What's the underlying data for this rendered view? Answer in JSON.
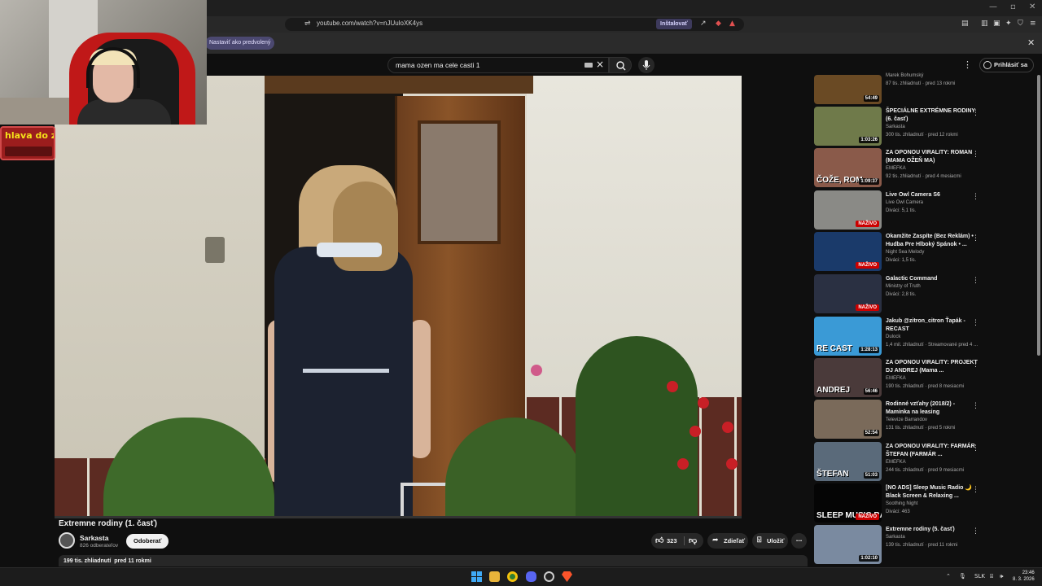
{
  "browser": {
    "url": "youtube.com/watch?v=nJUuloXK4ys",
    "install_label": "Inštalovať",
    "set_default_label": "Nastaviť ako predvolený",
    "infobar_close": "✕"
  },
  "masthead": {
    "search_query": "mama ozen ma cele casti 1",
    "signin_label": "Prihlásiť sa"
  },
  "video": {
    "title": "Extremne rodiny (1. časť)",
    "channel": "Sarkasta",
    "subscribers": "826 odberateľov",
    "subscribe_label": "Odoberať",
    "likes": "323",
    "share_label": "Zdieľať",
    "save_label": "Uložiť",
    "views": "199 tis. zhliadnutí",
    "age": "pred 11 rokmi"
  },
  "webcam": {
    "label": "hlava do ze"
  },
  "recommendations": [
    {
      "title": "",
      "channel": "Marek Bohumský",
      "meta": "87 tis. zhliadnutí · pred 13 rokmi",
      "duration": "54:49",
      "thumb": "#6a4a24",
      "overlay": ""
    },
    {
      "title": "ŠPECIÁLNE EXTRÉMNE RODINY (6. časť)",
      "channel": "Sarkasta",
      "meta": "300 tis. zhliadnutí · pred 12 rokmi",
      "duration": "1:03:26",
      "thumb": "#6f7a4a",
      "overlay": ""
    },
    {
      "title": "ZA OPONOU VIRALITY: ROMAN (MAMA OŽEŇ MA)",
      "channel": "EMEFKA",
      "meta": "92 tis. zhliadnutí · pred 4 mesiacmi",
      "duration": "1:09:37",
      "thumb": "#8a5a4a",
      "overlay": "ČOŽE, ROM"
    },
    {
      "title": "Live Owl Camera S6",
      "channel": "Live Owl Camera",
      "meta": "Diváci: 5,1 tis.",
      "live": "NAŽIVO",
      "thumb": "#8a8a86",
      "overlay": ""
    },
    {
      "title": "Okamžite Zaspíte (Bez Reklám) • Hudba Pre Hlboký Spánok • ...",
      "channel": "Night Sea Melody",
      "meta": "Diváci: 1,5 tis.",
      "live": "NAŽIVO",
      "thumb": "#1a3a6a",
      "overlay": ""
    },
    {
      "title": "Galactic Command",
      "channel": "Ministry of Truth",
      "meta": "Diváci: 2,8 tis.",
      "live": "NAŽIVO",
      "thumb": "#2a3042",
      "overlay": ""
    },
    {
      "title": "Jakub @zitron_citron Ťapák - RECAST",
      "channel": "Dulock",
      "meta": "1,4 mil. zhliadnutí · Streamované pred 4 ...",
      "duration": "1:28:13",
      "thumb": "#3a9ad6",
      "overlay": "RE CAST"
    },
    {
      "title": "ZA OPONOU VIRALITY: PROJEKT DJ ANDREJ (Mama ...",
      "channel": "EMEFKA",
      "meta": "190 tis. zhliadnutí · pred 8 mesiacmi",
      "duration": "56:46",
      "thumb": "#4a3a3a",
      "overlay": "ANDREJ"
    },
    {
      "title": "Rodinné vzťahy (2018/2) - Maminka na leasing",
      "channel": "Televize Barrandov",
      "meta": "131 tis. zhliadnutí · pred 5 rokmi",
      "duration": "52:54",
      "thumb": "#7a6a5a",
      "overlay": ""
    },
    {
      "title": "ZA OPONOU VIRALITY: FARMÁR ŠTEFAN (FARMÁR ...",
      "channel": "EMEFKA",
      "meta": "244 tis. zhliadnutí · pred 9 mesiacmi",
      "duration": "51:03",
      "thumb": "#5a6a7a",
      "overlay": "ŠTEFAN"
    },
    {
      "title": "[NO ADS] Sleep Music Radio 🌙 Black Screen & Relaxing ...",
      "channel": "Soothing Night",
      "meta": "Diváci: 463",
      "live": "NAŽIVO",
      "thumb": "#050505",
      "overlay": "SLEEP MUSIC RADIO"
    },
    {
      "title": "Extremne rodiny (5. časť)",
      "channel": "Sarkasta",
      "meta": "139 tis. zhliadnutí · pred 11 rokmi",
      "duration": "1:02:10",
      "thumb": "#7a8aa0",
      "overlay": ""
    }
  ],
  "taskbar": {
    "lang": "SLK",
    "time": "23:46",
    "date": "8. 3. 2026"
  }
}
